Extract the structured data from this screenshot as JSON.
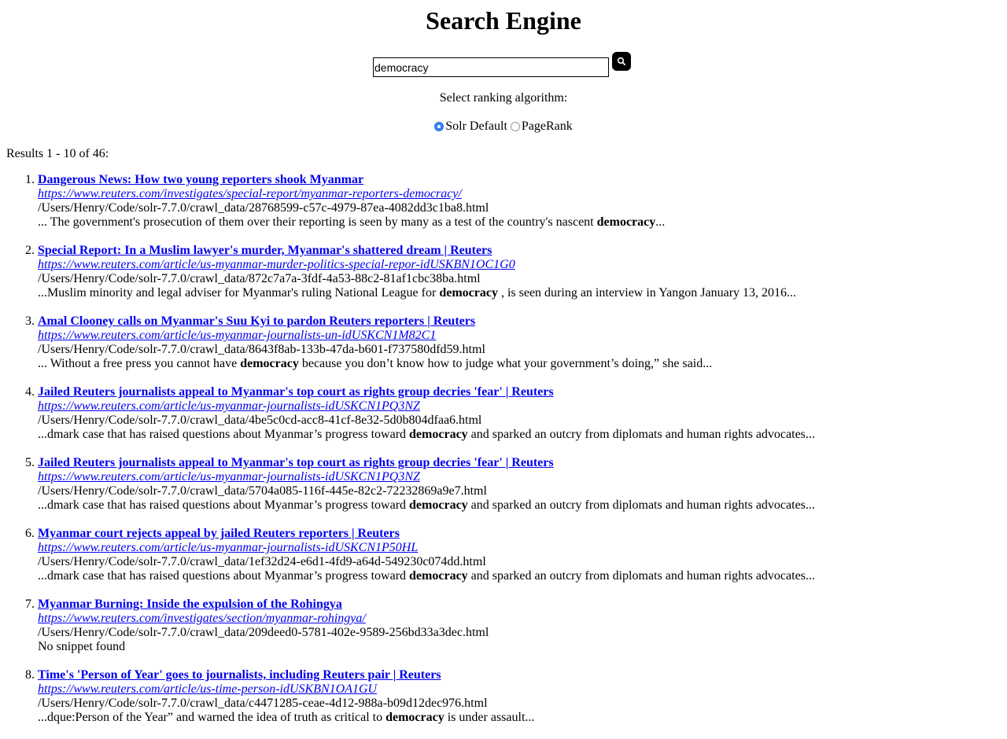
{
  "header": {
    "title": "Search Engine"
  },
  "search": {
    "value": "democracy"
  },
  "ranking": {
    "label": "Select ranking algorithm:",
    "options": [
      {
        "label": "Solr Default",
        "selected": true
      },
      {
        "label": "PageRank",
        "selected": false
      }
    ]
  },
  "results_summary": "Results 1 - 10 of 46:",
  "results": [
    {
      "title": "Dangerous News: How two young reporters shook Myanmar",
      "url": "https://www.reuters.com/investigates/special-report/myanmar-reporters-democracy/",
      "path": "/Users/Henry/Code/solr-7.7.0/crawl_data/28768599-c57c-4979-87ea-4082dd3c1ba8.html",
      "snippet_pre": "... The government's prosecution of them over their reporting is seen by many as a test of the country's nascent ",
      "snippet_term": "democracy",
      "snippet_post": "..."
    },
    {
      "title": "Special Report: In a Muslim lawyer's murder, Myanmar's shattered dream | Reuters",
      "url": "https://www.reuters.com/article/us-myanmar-murder-politics-special-repor-idUSKBN1OC1G0",
      "path": "/Users/Henry/Code/solr-7.7.0/crawl_data/872c7a7a-3fdf-4a53-88c2-81af1cbc38ba.html",
      "snippet_pre": "...Muslim minority and legal adviser for Myanmar's ruling National League for ",
      "snippet_term": "democracy",
      "snippet_post": " , is seen during an interview in Yangon January 13, 2016..."
    },
    {
      "title": "Amal Clooney calls on Myanmar's Suu Kyi to pardon Reuters reporters | Reuters",
      "url": "https://www.reuters.com/article/us-myanmar-journalists-un-idUSKCN1M82C1",
      "path": "/Users/Henry/Code/solr-7.7.0/crawl_data/8643f8ab-133b-47da-b601-f737580dfd59.html",
      "snippet_pre": "... Without a free press you cannot have ",
      "snippet_term": "democracy",
      "snippet_post": " because you don’t know how to judge what your government’s doing,” she said..."
    },
    {
      "title": "Jailed Reuters journalists appeal to Myanmar's top court as rights group decries 'fear' | Reuters",
      "url": "https://www.reuters.com/article/us-myanmar-journalists-idUSKCN1PQ3NZ",
      "path": "/Users/Henry/Code/solr-7.7.0/crawl_data/4be5c0cd-acc8-41cf-8e32-5d0b804dfaa6.html",
      "snippet_pre": "...dmark case that has raised questions about Myanmar’s progress toward ",
      "snippet_term": "democracy",
      "snippet_post": " and sparked an outcry from diplomats and human rights advocates..."
    },
    {
      "title": "Jailed Reuters journalists appeal to Myanmar's top court as rights group decries 'fear' | Reuters",
      "url": "https://www.reuters.com/article/us-myanmar-journalists-idUSKCN1PQ3NZ",
      "path": "/Users/Henry/Code/solr-7.7.0/crawl_data/5704a085-116f-445e-82c2-72232869a9e7.html",
      "snippet_pre": "...dmark case that has raised questions about Myanmar’s progress toward ",
      "snippet_term": "democracy",
      "snippet_post": " and sparked an outcry from diplomats and human rights advocates..."
    },
    {
      "title": "Myanmar court rejects appeal by jailed Reuters reporters | Reuters",
      "url": "https://www.reuters.com/article/us-myanmar-journalists-idUSKCN1P50HL",
      "path": "/Users/Henry/Code/solr-7.7.0/crawl_data/1ef32d24-e6d1-4fd9-a64d-549230c074dd.html",
      "snippet_pre": "...dmark case that has raised questions about Myanmar’s progress toward ",
      "snippet_term": "democracy",
      "snippet_post": " and sparked an outcry from diplomats and human rights advocates..."
    },
    {
      "title": "Myanmar Burning: Inside the expulsion of the Rohingya",
      "url": "https://www.reuters.com/investigates/section/myanmar-rohingya/",
      "path": "/Users/Henry/Code/solr-7.7.0/crawl_data/209deed0-5781-402e-9589-256bd33a3dec.html",
      "snippet_pre": "No snippet found",
      "snippet_term": "",
      "snippet_post": ""
    },
    {
      "title": "Time's 'Person of Year' goes to journalists, including Reuters pair | Reuters",
      "url": "https://www.reuters.com/article/us-time-person-idUSKBN1OA1GU",
      "path": "/Users/Henry/Code/solr-7.7.0/crawl_data/c4471285-ceae-4d12-988a-b09d12dec976.html",
      "snippet_pre": "...dque:Person of the Year” and warned the idea of truth as critical to ",
      "snippet_term": "democracy",
      "snippet_post": " is under assault..."
    }
  ]
}
